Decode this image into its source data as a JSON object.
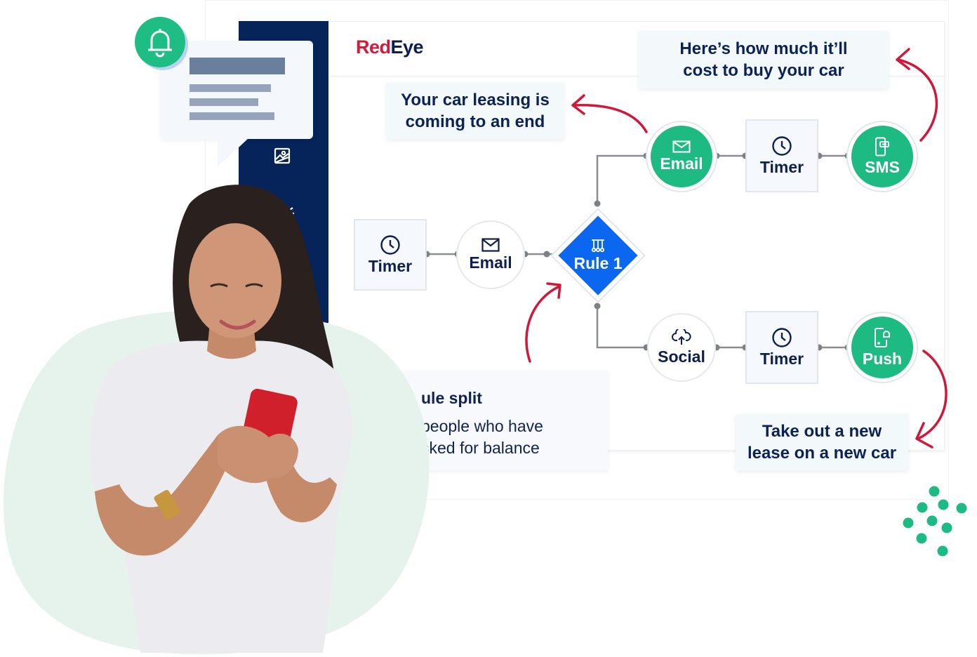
{
  "brand": {
    "logo_part1": "Red",
    "logo_part2": "Eye",
    "colors": {
      "logo_red": "#d41a3c",
      "navy": "#0d1f4c",
      "sidebar": "#062459",
      "green": "#1dba83",
      "rule_blue": "#0b66f0",
      "arrow_red": "#d0183a",
      "blob": "#e6f3ec"
    }
  },
  "sidebar": {
    "icons": [
      "image-icon",
      "megaphone-icon"
    ]
  },
  "notification": {
    "icon": "bell-icon"
  },
  "callouts": {
    "top_left": {
      "line1": "Your car leasing is",
      "line2": "coming to an end"
    },
    "top_right": {
      "line1": "Here’s how much it’ll",
      "line2": "cost to buy your car"
    },
    "bottom_right": {
      "line1": "Take out a new",
      "line2": "lease on a new car"
    }
  },
  "flow": {
    "start_timer": {
      "label": "Timer",
      "icon": "clock-icon"
    },
    "start_email": {
      "label": "Email",
      "icon": "mail-icon"
    },
    "rule": {
      "label": "Rule 1",
      "icon": "split-rule-icon"
    },
    "upper_branch": [
      {
        "label": "Email",
        "icon": "mail-icon",
        "style": "green"
      },
      {
        "label": "Timer",
        "icon": "clock-icon",
        "style": "box"
      },
      {
        "label": "SMS",
        "icon": "phone-message-icon",
        "style": "green"
      }
    ],
    "lower_branch": [
      {
        "label": "Social",
        "icon": "cloud-upload-icon",
        "style": "white"
      },
      {
        "label": "Timer",
        "icon": "clock-icon",
        "style": "box"
      },
      {
        "label": "Push",
        "icon": "phone-bell-icon",
        "style": "green"
      }
    ]
  },
  "rule_split": {
    "title": "ule split",
    "desc_line1": "people who have",
    "desc_line2": "sked for balance"
  }
}
